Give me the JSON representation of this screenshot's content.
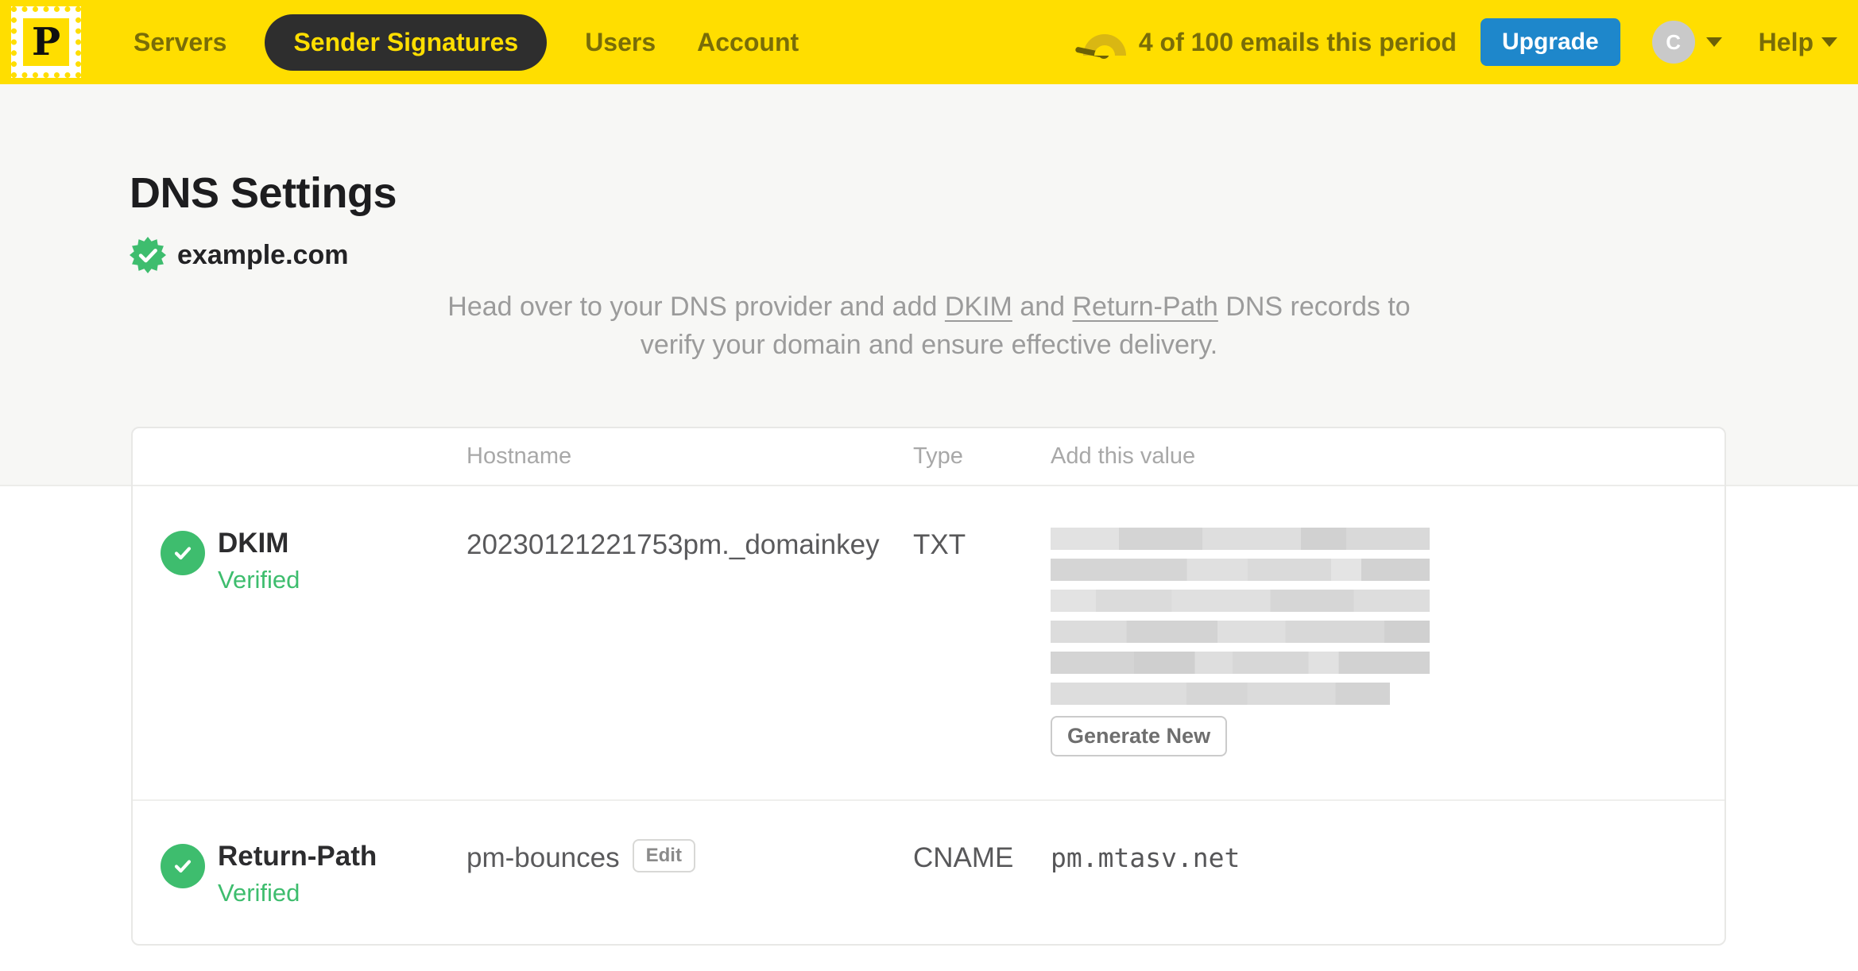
{
  "nav": {
    "logo_letter": "P",
    "items": [
      {
        "label": "Servers",
        "active": false
      },
      {
        "label": "Sender Signatures",
        "active": true
      },
      {
        "label": "Users",
        "active": false
      },
      {
        "label": "Account",
        "active": false
      }
    ],
    "usage_text": "4 of 100 emails this period",
    "upgrade_label": "Upgrade",
    "avatar_initial": "C",
    "help_label": "Help"
  },
  "page": {
    "title": "DNS Settings",
    "domain": "example.com",
    "description": {
      "before": "Head over to your DNS provider and add ",
      "link_dkim": "DKIM",
      "middle": " and ",
      "link_return_path": "Return-Path",
      "after": " DNS records to verify your domain and ensure effective delivery."
    }
  },
  "table": {
    "headers": {
      "hostname": "Hostname",
      "type": "Type",
      "value": "Add this value"
    },
    "rows": [
      {
        "name": "DKIM",
        "status": "Verified",
        "hostname": "20230121221753pm._domainkey",
        "type": "TXT",
        "value_redacted": true,
        "action_label": "Generate New"
      },
      {
        "name": "Return-Path",
        "status": "Verified",
        "hostname": "pm-bounces",
        "edit_label": "Edit",
        "type": "CNAME",
        "value": "pm.mtasv.net"
      }
    ]
  },
  "colors": {
    "brand-yellow": "#ffde00",
    "nav-ink": "#796d08",
    "pill-bg": "#2e2e2e",
    "upgrade-blue": "#1e87cb",
    "success-green": "#3ebd6e",
    "ink": "#1d1d1f",
    "muted": "#9b9b9b"
  }
}
